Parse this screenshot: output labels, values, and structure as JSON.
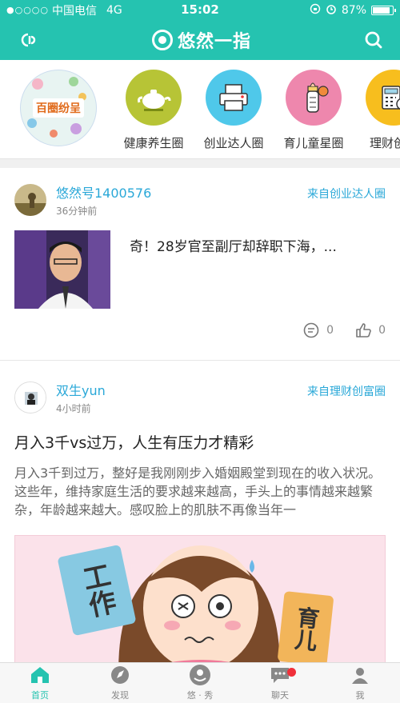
{
  "status_bar": {
    "signal_dots": "●○○○○",
    "carrier": "中国电信",
    "network": "4G",
    "time": "15:02",
    "battery": "87%"
  },
  "header": {
    "title": "悠然一指"
  },
  "circles": [
    {
      "label": "",
      "badge": "百圈纷呈"
    },
    {
      "label": "健康养生圈",
      "color": "#b7c436"
    },
    {
      "label": "创业达人圈",
      "color": "#4fc8ea"
    },
    {
      "label": "育儿童星圈",
      "color": "#ee87ad"
    },
    {
      "label": "理财创富",
      "color": "#f7be1e"
    }
  ],
  "posts": [
    {
      "user": "悠然号1400576",
      "time": "36分钟前",
      "source": "来自创业达人圈",
      "title": "奇！28岁官至副厅却辞职下海，...",
      "comments": "0",
      "likes": "0"
    },
    {
      "user": "双生yun",
      "time": "4小时前",
      "source": "来自理财创富圈",
      "title": "月入3千vs过万，人生有压力才精彩",
      "text": "月入3千到过万，整好是我刚刚步入婚姻殿堂到现在的收入状况。这些年，维持家庭生活的要求越来越高，手头上的事情越来越繁杂，年龄越来越大。感叹脸上的肌肤不再像当年一",
      "image_cards": [
        "工作",
        "育儿"
      ]
    }
  ],
  "tabbar": {
    "tabs": [
      {
        "label": "首页"
      },
      {
        "label": "发现"
      },
      {
        "label": "悠 · 秀"
      },
      {
        "label": "聊天"
      },
      {
        "label": "我"
      }
    ]
  },
  "colors": {
    "brand": "#25c3b0",
    "link": "#2aa8d8",
    "badge_red": "#f0303a"
  }
}
